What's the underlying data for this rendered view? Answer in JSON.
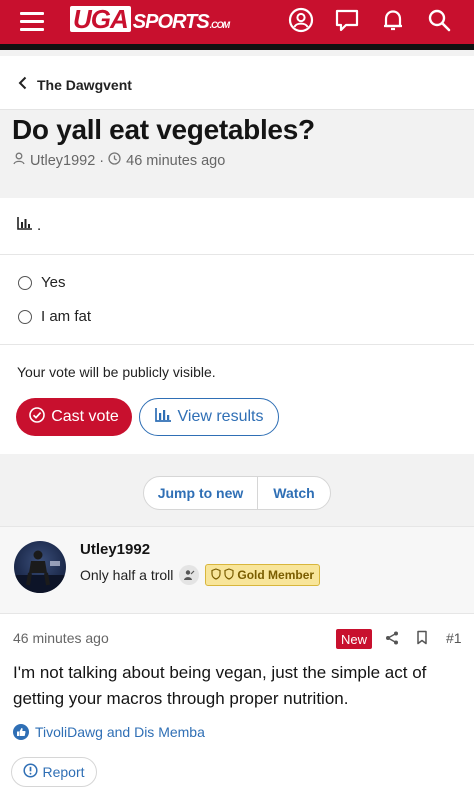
{
  "header": {
    "logo_main": "UGA",
    "logo_sports": "SPORTS",
    "logo_com": ".COM",
    "icons": [
      "menu-icon",
      "account-icon",
      "messages-icon",
      "alerts-icon",
      "search-icon"
    ]
  },
  "breadcrumb": {
    "label": "The Dawgvent"
  },
  "thread": {
    "title": "Do yall eat vegetables?",
    "author": "Utley1992",
    "separator": "·",
    "time": "46 minutes ago"
  },
  "poll": {
    "question": ".",
    "options": [
      "Yes",
      "I am fat"
    ],
    "notice": "Your vote will be publicly visible.",
    "vote_label": "Cast vote",
    "results_label": "View results"
  },
  "thread_actions": {
    "jump_label": "Jump to new",
    "watch_label": "Watch"
  },
  "user": {
    "name": "Utley1992",
    "title": "Only half a troll",
    "badge": "Gold Member"
  },
  "post": {
    "time": "46 minutes ago",
    "new_badge": "New",
    "number": "#1",
    "body": "I'm not talking about being vegan, just the simple act of getting your macros through proper nutrition.",
    "reactions": "TivoliDawg and Dis Memba",
    "report_label": "Report"
  },
  "colors": {
    "brand_red": "#c8102e",
    "link_blue": "#2f6fb5",
    "gold": "#f8e59a"
  }
}
